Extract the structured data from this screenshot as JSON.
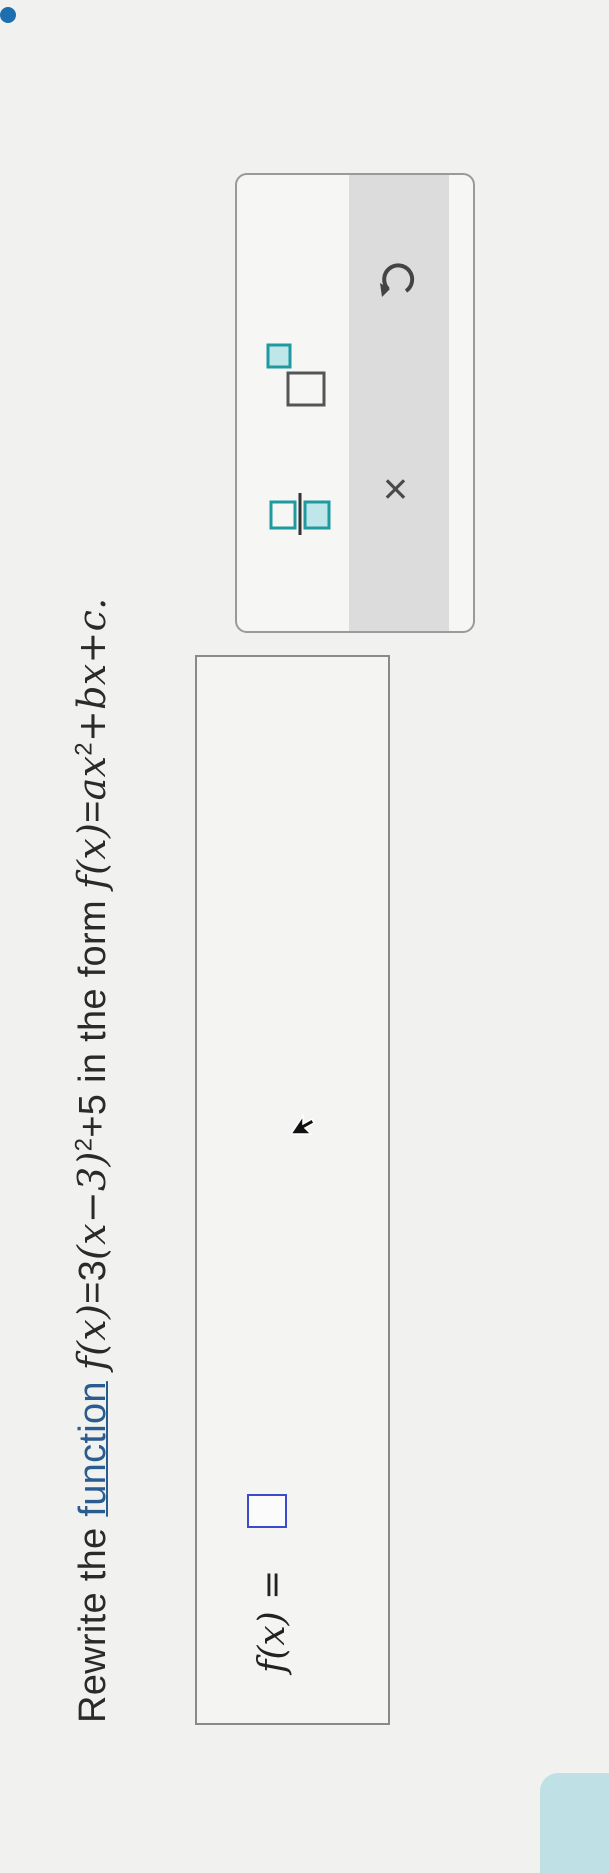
{
  "question": {
    "prefix": "Rewrite the ",
    "link": "function",
    "given": {
      "fx": "f(x)",
      "eq": "=3",
      "inner": "(x−3)",
      "exp": "2",
      "tail": "+5"
    },
    "middle": " in the form ",
    "target": {
      "fx": "f(x)",
      "eq": "=",
      "a": "ax",
      "exp": "2",
      "rest": "+bx+c."
    }
  },
  "answer": {
    "label": "f(x) ="
  },
  "palette": {
    "fraction_icon": "fraction-icon",
    "power_icon": "superscript-icon",
    "clear_label": "×",
    "undo_icon": "undo-icon"
  },
  "colors": {
    "input_border": "#3a4bd0",
    "tool_teal": "#1f9aa0",
    "link": "#2a5c8f"
  }
}
